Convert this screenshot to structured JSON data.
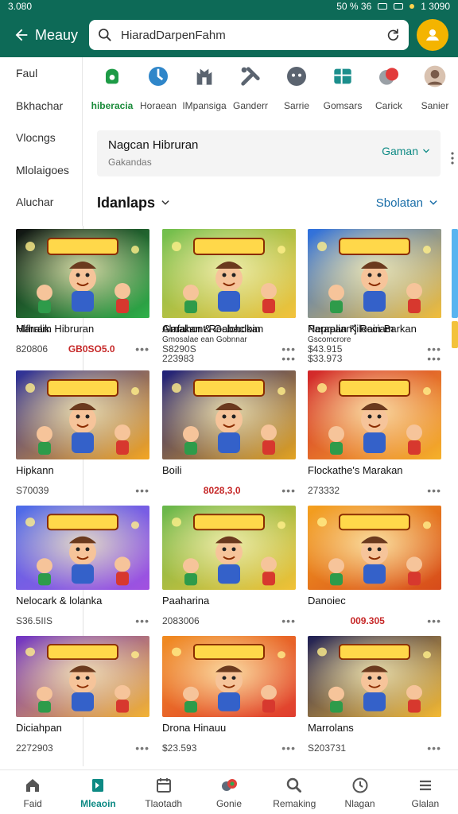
{
  "status_bar": {
    "time": "3.080",
    "signal": "50 % 36",
    "battery": "1 3090"
  },
  "app_bar": {
    "back_label": "Meauy",
    "search_text": "HiaradDarpenFahm"
  },
  "sidebar": {
    "items": [
      {
        "label": "Faul"
      },
      {
        "label": "Bkhachar"
      },
      {
        "label": "Vlocngs"
      },
      {
        "label": "Mlolaigoes"
      },
      {
        "label": "Aluchar"
      }
    ]
  },
  "categories": [
    {
      "label": "hiberacia",
      "icon": "controller-icon",
      "active": true,
      "color": "#1d9b46"
    },
    {
      "label": "Horaean",
      "icon": "sky-icon",
      "color": "#2f86c9"
    },
    {
      "label": "IMpansiga",
      "icon": "castle-icon",
      "color": "#5b6470"
    },
    {
      "label": "Ganderr",
      "icon": "tools-icon",
      "color": "#5b6470"
    },
    {
      "label": "Sarrie",
      "icon": "gamepad-icon",
      "color": "#5b6470"
    },
    {
      "label": "Gomsars",
      "icon": "puzzle-icon",
      "color": "#1b8e8c"
    },
    {
      "label": "Carick",
      "icon": "cricket-icon",
      "color": "#e23b3b"
    },
    {
      "label": "Sanier",
      "icon": "profile-photo-icon",
      "color": "#7a5b4a"
    }
  ],
  "filter": {
    "title": "Nagcan Hibruran",
    "subtitle": "Gakandas",
    "picker_label": "Gaman"
  },
  "section": {
    "heading": "Idanlaps",
    "sort_label": "Sbolatan"
  },
  "games": [
    {
      "title": "Marram Hibruran",
      "subtitle": "",
      "meta": "820806",
      "price": "GB0SO5.0",
      "thumb_bg": "#c07cf0",
      "thumb_bg2": "#f2c04a"
    },
    {
      "title": "Alafahont Roclohdkan",
      "subtitle": "Gmosalae ean Gobnnar",
      "meta": "223983",
      "price": "",
      "thumb_bg": "#f38b1e",
      "thumb_bg2": "#e24630"
    },
    {
      "title": "Nepralian'] Rain Barkan",
      "subtitle": "Gscomcrore",
      "meta": "$33.973",
      "price": "",
      "thumb_bg": "#49a6e8",
      "thumb_bg2": "#6fcf4a"
    },
    {
      "title": "Hipkann",
      "subtitle": "",
      "meta": "S70039",
      "price": "",
      "thumb_bg": "#2a2f9a",
      "thumb_bg2": "#f3a623"
    },
    {
      "title": "Boili",
      "subtitle": "",
      "meta": "",
      "price": "8028,3,0",
      "thumb_bg": "#1d1f7a",
      "thumb_bg2": "#e2a322"
    },
    {
      "title": "Flockathe's Marakan",
      "subtitle": "",
      "meta": "273332",
      "price": "",
      "thumb_bg": "#d2252a",
      "thumb_bg2": "#f5b12a"
    },
    {
      "title": "Nelocark & lolanka",
      "subtitle": "",
      "meta": "S36.5IIS",
      "price": "",
      "thumb_bg": "#4b6ce8",
      "thumb_bg2": "#a250e0"
    },
    {
      "title": "Paaharina",
      "subtitle": "",
      "meta": "2083006",
      "price": "",
      "thumb_bg": "#67b84c",
      "thumb_bg2": "#f1c136"
    },
    {
      "title": "Danoiec",
      "subtitle": "",
      "meta": "",
      "price": "009.305",
      "thumb_bg": "#f4a11f",
      "thumb_bg2": "#d74b1b"
    },
    {
      "title": "Diciahpan",
      "subtitle": "",
      "meta": "2272903",
      "price": "",
      "thumb_bg": "#6f33c7",
      "thumb_bg2": "#f2b233"
    },
    {
      "title": "Drona Hinauu",
      "subtitle": "",
      "meta": "$23.593",
      "price": "",
      "thumb_bg": "#f08c21",
      "thumb_bg2": "#e03d2f"
    },
    {
      "title": "Marrolans",
      "subtitle": "",
      "meta": "S203731",
      "price": "",
      "thumb_bg": "#1e1f55",
      "thumb_bg2": "#f3b934"
    },
    {
      "title": "Hlfhalik",
      "subtitle": "",
      "meta": "",
      "price": "",
      "thumb_bg": "#111111",
      "thumb_bg2": "#2fb14a"
    },
    {
      "title": "Gmakan & Gabacloin",
      "subtitle": "",
      "meta": "S8290S",
      "price": "",
      "thumb_bg": "#6fbf4e",
      "thumb_bg2": "#f3c23b"
    },
    {
      "title": "Parapan Kilocciam",
      "subtitle": "",
      "meta": "$43.915",
      "price": "",
      "thumb_bg": "#2b6fe0",
      "thumb_bg2": "#f1bd3a"
    }
  ],
  "bottom_nav": [
    {
      "label": "Faid",
      "icon": "home-icon"
    },
    {
      "label": "Mleaoin",
      "icon": "book-icon",
      "active": true
    },
    {
      "label": "Tlaotadh",
      "icon": "calendar-icon"
    },
    {
      "label": "Gonie",
      "icon": "game-center-icon"
    },
    {
      "label": "Remaking",
      "icon": "search-icon"
    },
    {
      "label": "Nlagan",
      "icon": "clock-icon"
    },
    {
      "label": "Glalan",
      "icon": "menu-icon"
    }
  ],
  "colors": {
    "primary": "#0d6a57",
    "accent": "#0d8a84",
    "price": "#c62828",
    "link": "#1a6ea8"
  }
}
